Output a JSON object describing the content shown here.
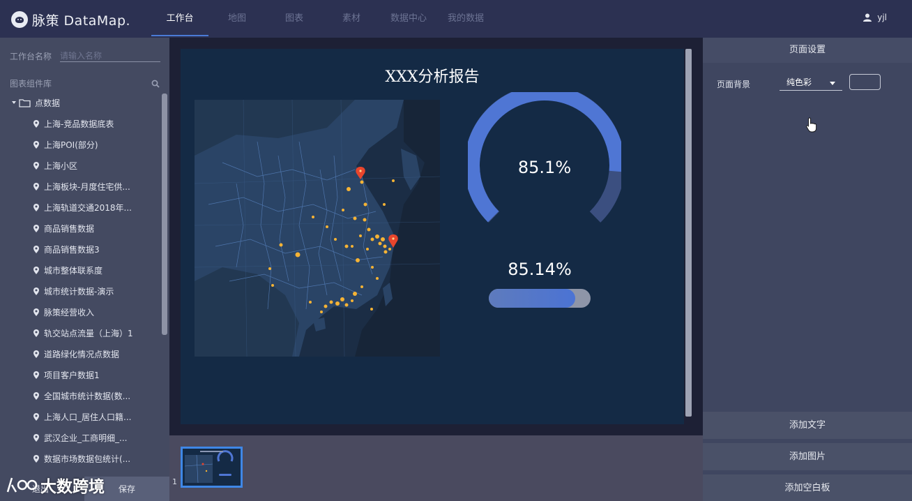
{
  "app": {
    "brand": "脉策 DataMap."
  },
  "nav": {
    "items": [
      {
        "label": "工作台"
      },
      {
        "label": "地图"
      },
      {
        "label": "图表"
      },
      {
        "label": "素材"
      },
      {
        "label": "数据中心"
      },
      {
        "label": "我的数据"
      }
    ],
    "active": "工作台"
  },
  "user": {
    "name": "yjl"
  },
  "left": {
    "name_label": "工作台名称",
    "name_placeholder": "请输入名称",
    "library_label": "图表组件库",
    "folder": "点数据",
    "items": [
      {
        "label": "上海-竞品数据底表"
      },
      {
        "label": "上海POI(部分)"
      },
      {
        "label": "上海小区"
      },
      {
        "label": "上海板块-月度住宅供..."
      },
      {
        "label": "上海轨道交通2018年..."
      },
      {
        "label": "商品销售数据"
      },
      {
        "label": "商品销售数据3"
      },
      {
        "label": "城市整体联系度"
      },
      {
        "label": "城市统计数据-演示"
      },
      {
        "label": "脉策经营收入"
      },
      {
        "label": "轨交站点流量（上海）1"
      },
      {
        "label": "道路绿化情况点数据"
      },
      {
        "label": "项目客户数据1"
      },
      {
        "label": "全国城市统计数据(数..."
      },
      {
        "label": "上海人口_居住人口籍..."
      },
      {
        "label": "武汉企业_工商明细_..."
      },
      {
        "label": "数据市场数据包统计(..."
      }
    ],
    "exit_label": "退出",
    "save_label": "保存"
  },
  "canvas": {
    "title": "XXX分析报告",
    "gauge_value": "85.1%",
    "gauge_fraction": 0.851,
    "progress_value": "85.14%",
    "progress_fraction": 0.8514
  },
  "pages": {
    "current": "1"
  },
  "right": {
    "header": "页面设置",
    "bg_label": "页面背景",
    "bg_option": "纯色彩",
    "add_text": "添加文字",
    "add_image": "添加图片",
    "add_blank": "添加空白板"
  },
  "watermark": {
    "text": "大数跨境"
  },
  "colors": {
    "accent": "#4a7bd6",
    "canvas_bg": "#142a45",
    "gauge": "#4f76d4",
    "marker": "#f5b335",
    "marker_hot": "#e8452c"
  }
}
